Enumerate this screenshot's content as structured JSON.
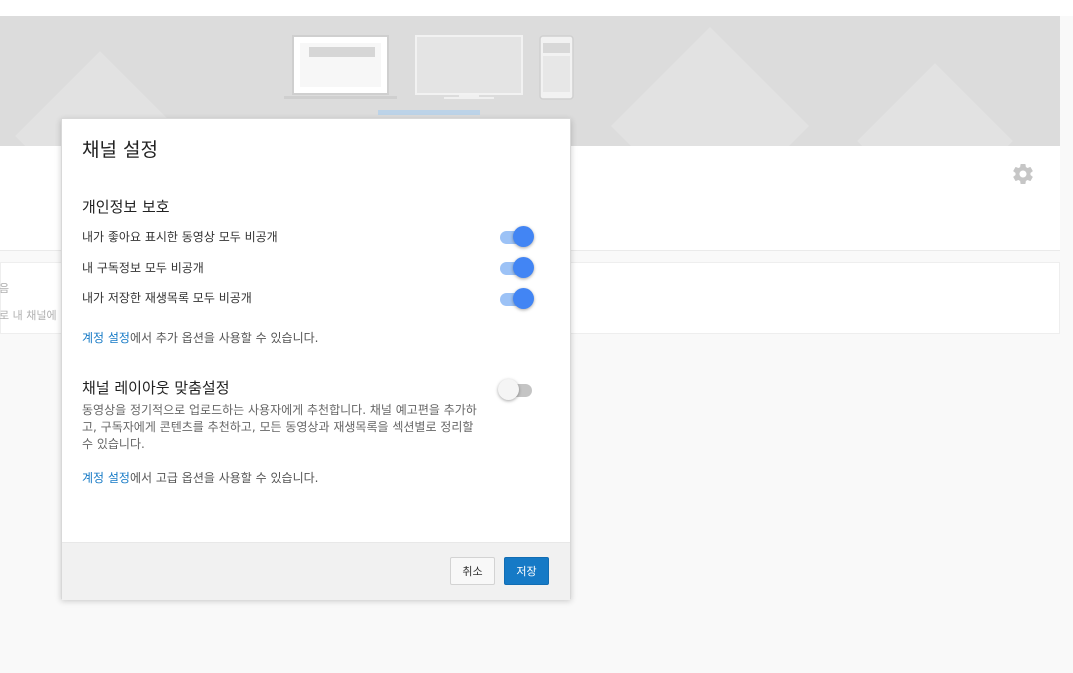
{
  "page": {
    "background_color": "#f9f9f9",
    "banner_color": "#dcdcdc"
  },
  "content": {
    "fragment_1": "음",
    "fragment_2": "로 내 채널에"
  },
  "dialog": {
    "title": "채널 설정",
    "privacy": {
      "title": "개인정보 보호",
      "items": [
        {
          "label": "내가 좋아요 표시한 동영상 모두 비공개",
          "enabled": true
        },
        {
          "label": "내 구독정보 모두 비공개",
          "enabled": true
        },
        {
          "label": "내가 저장한 재생목록 모두 비공개",
          "enabled": true
        }
      ],
      "hint_link": "계정 설정",
      "hint_rest": "에서 추가 옵션을 사용할 수 있습니다."
    },
    "layout": {
      "title": "채널 레이아웃 맞춤설정",
      "enabled": false,
      "description": "동영상을 정기적으로 업로드하는 사용자에게 추천합니다. 채널 예고편을 추가하고, 구독자에게 콘텐츠를 추천하고, 모든 동영상과 재생목록을 섹션별로 정리할 수 있습니다.",
      "hint_link": "계정 설정",
      "hint_rest": "에서 고급 옵션을 사용할 수 있습니다."
    },
    "buttons": {
      "cancel": "취소",
      "save": "저장"
    },
    "colors": {
      "link": "#167ac6",
      "toggle_on": "#4285f4",
      "primary_button": "#167ac6"
    }
  },
  "icons": {
    "settings": "gear-icon",
    "banner_devices": [
      "laptop-icon",
      "tv-icon",
      "phone-icon"
    ]
  }
}
